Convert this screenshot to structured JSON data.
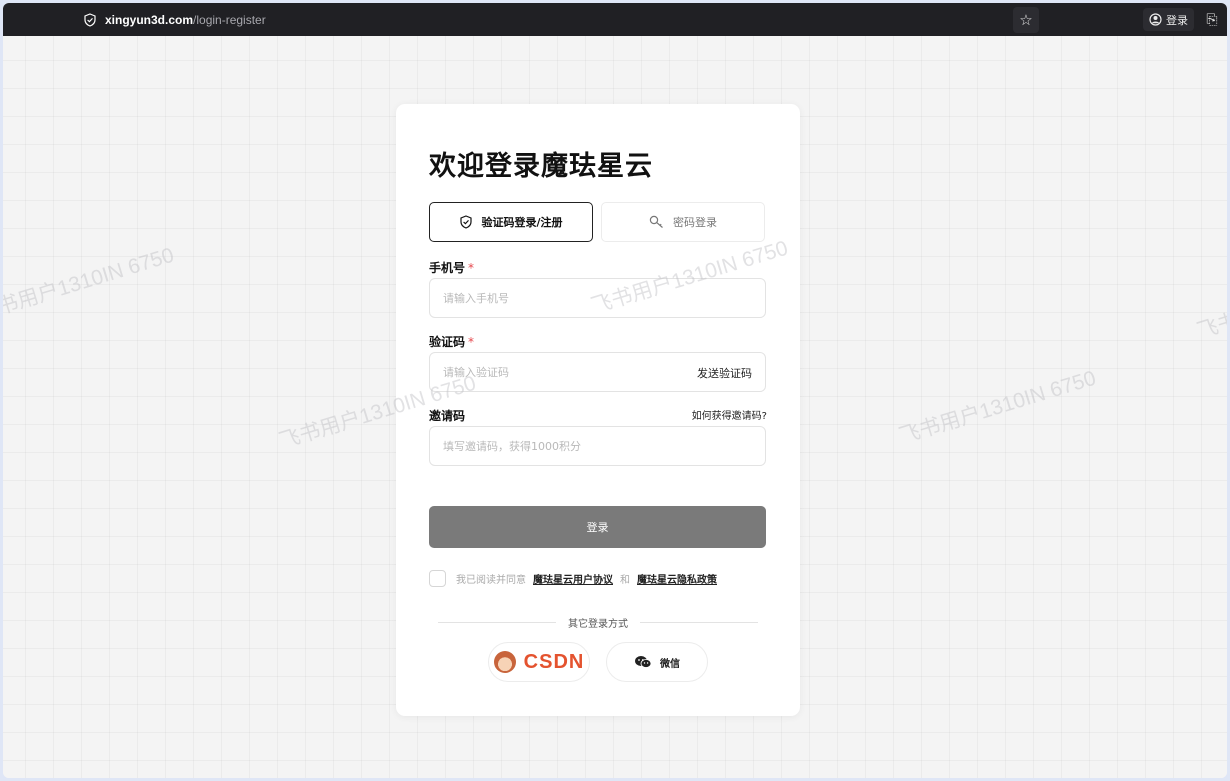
{
  "browser": {
    "url_host": "xingyun3d.com",
    "url_path": "/login-register",
    "account_label": "登录"
  },
  "watermark": "飞书用户1310IN 6750",
  "login": {
    "title": "欢迎登录魔珐星云",
    "tabs": [
      {
        "label": "验证码登录/注册",
        "active": true,
        "icon": "shield-check-icon"
      },
      {
        "label": "密码登录",
        "active": false,
        "icon": "key-icon"
      }
    ],
    "phone": {
      "label": "手机号",
      "required_mark": "*",
      "placeholder": "请输入手机号"
    },
    "code": {
      "label": "验证码",
      "required_mark": "*",
      "placeholder": "请输入验证码",
      "send_label": "发送验证码"
    },
    "invite": {
      "label": "邀请码",
      "help_link": "如何获得邀请码?",
      "placeholder": "填写邀请码，获得1000积分"
    },
    "submit_label": "登录",
    "agreement": {
      "prefix": "我已阅读并同意",
      "terms": "魔珐星云用户协议",
      "and": "和",
      "privacy": "魔珐星云隐私政策"
    },
    "other_methods_label": "其它登录方式",
    "social": [
      {
        "label": "CSDN",
        "icon": "csdn-logo"
      },
      {
        "label": "微信",
        "icon": "wechat-icon"
      }
    ]
  },
  "colors": {
    "submit_bg": "#7a7a7a",
    "required": "#e5484d",
    "csdn": "#e4532f"
  }
}
